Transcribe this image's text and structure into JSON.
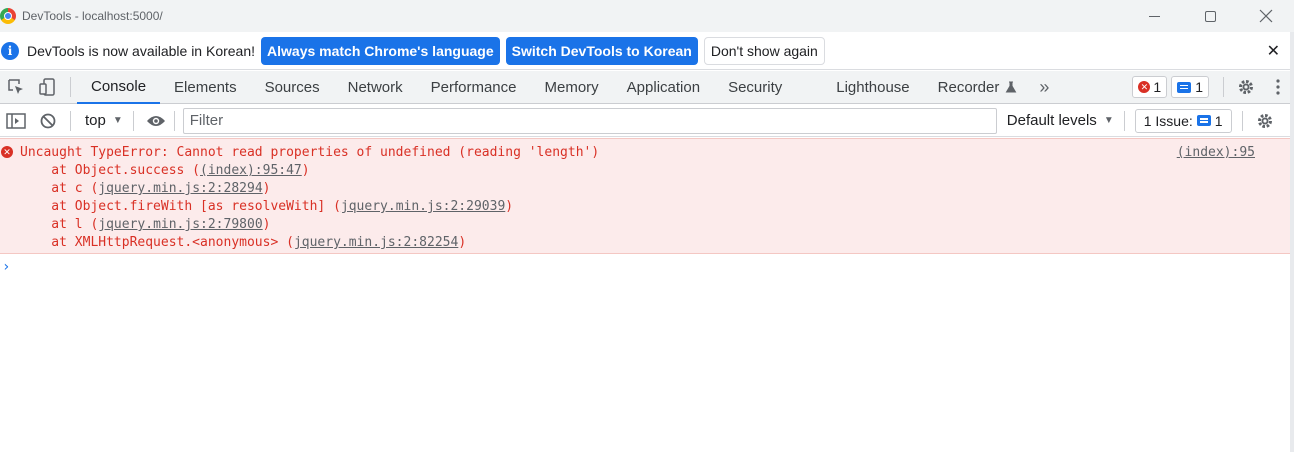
{
  "window": {
    "title": "DevTools - localhost:5000/"
  },
  "infobar": {
    "message": "DevTools is now available in Korean!",
    "match_button": "Always match Chrome's language",
    "switch_button": "Switch DevTools to Korean",
    "dismiss_button": "Don't show again",
    "close_glyph": "✕"
  },
  "tabs": [
    {
      "label": "Console",
      "active": true
    },
    {
      "label": "Elements"
    },
    {
      "label": "Sources"
    },
    {
      "label": "Network"
    },
    {
      "label": "Performance"
    },
    {
      "label": "Memory"
    },
    {
      "label": "Application"
    },
    {
      "label": "Security"
    },
    {
      "label": "Lighthouse"
    },
    {
      "label": "Recorder"
    }
  ],
  "tab_more": "»",
  "counters": {
    "errors": "1",
    "messages": "1"
  },
  "toolbar": {
    "context": "top",
    "filter_placeholder": "Filter",
    "levels": "Default levels",
    "issues": "1 Issue:",
    "issues_count": "1"
  },
  "console": {
    "error_message": "Uncaught TypeError: Cannot read properties of undefined (reading 'length')",
    "source": "(index):95",
    "stack": [
      {
        "prefix": "    at Object.success (",
        "link": "(index):95:47",
        "suffix": ")"
      },
      {
        "prefix": "    at c (",
        "link": "jquery.min.js:2:28294",
        "suffix": ")"
      },
      {
        "prefix": "    at Object.fireWith [as resolveWith] (",
        "link": "jquery.min.js:2:29039",
        "suffix": ")"
      },
      {
        "prefix": "    at l (",
        "link": "jquery.min.js:2:79800",
        "suffix": ")"
      },
      {
        "prefix": "    at XMLHttpRequest.<anonymous> (",
        "link": "jquery.min.js:2:82254",
        "suffix": ")"
      }
    ],
    "prompt": "›"
  },
  "colors": {
    "accent": "#1a73e8",
    "error": "#d93025",
    "error_bg": "#fcebeb"
  }
}
